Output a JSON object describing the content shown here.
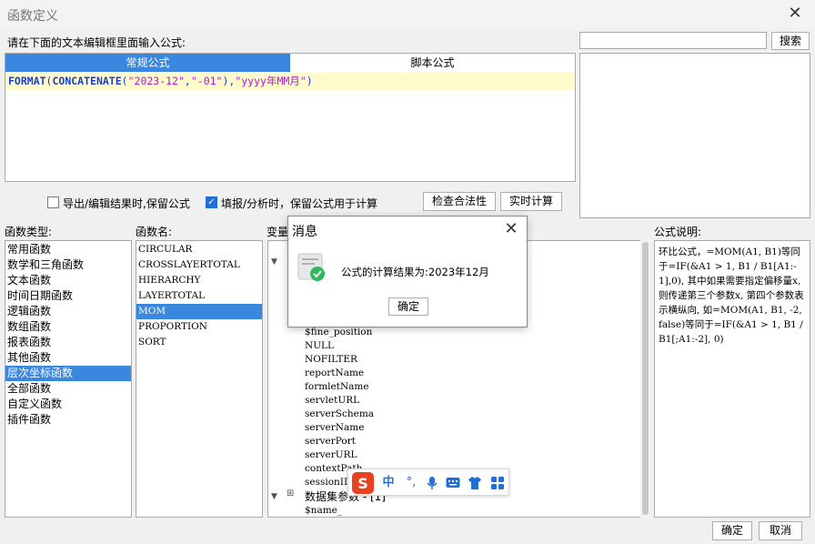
{
  "window": {
    "title": "函数定义"
  },
  "prompt": "请在下面的文本编辑框里面输入公式:",
  "search": {
    "value": "",
    "button": "搜索"
  },
  "tabs": {
    "normal": "常规公式",
    "script": "脚本公式"
  },
  "formula": {
    "parts": [
      "FORMAT",
      "(",
      "CONCATENATE",
      "(",
      "\"2023-12\"",
      ",",
      "\"-01\"",
      "),",
      "\"yyyy年MM月\"",
      ")"
    ]
  },
  "options": {
    "export_keep": {
      "label": "导出/编辑结果时,保留公式",
      "checked": false
    },
    "fill_keep": {
      "label": "填报/分析时，保留公式用于计算",
      "checked": true
    },
    "check_button": "检查合法性",
    "realtime_button": "实时计算"
  },
  "labels": {
    "func_type": "函数类型:",
    "func_name": "函数名:",
    "variables": "变量",
    "description": "公式说明:"
  },
  "func_types": [
    "常用函数",
    "数学和三角函数",
    "文本函数",
    "时间日期函数",
    "逻辑函数",
    "数组函数",
    "报表函数",
    "其他函数",
    "层次坐标函数",
    "全部函数",
    "自定义函数",
    "插件函数"
  ],
  "func_type_selected": 8,
  "func_names": [
    "CIRCULAR",
    "CROSSLAYERTOTAL",
    "HIERARCHY",
    "LAYERTOTAL",
    "MOM",
    "PROPORTION",
    "SORT"
  ],
  "func_name_selected": 4,
  "variables": {
    "items": [
      "$fine_position",
      "NULL",
      "NOFILTER",
      "reportName",
      "formletName",
      "servletURL",
      "serverSchema",
      "serverName",
      "serverPort",
      "serverURL",
      "contextPath",
      "sessionID"
    ],
    "dataset_group": "数据集参数 - [1]",
    "dataset_items": [
      "$name_"
    ]
  },
  "description_text": "环比公式，=MOM(A1, B1)等同于=IF(&A1 > 1, B1 / B1[A1:-1],0), 其中如果需要指定偏移量x, 则传递第三个参数x, 第四个参数表示横纵向, 如=MOM(A1, B1, -2, false)等同于=IF(&A1 > 1, B1 / B1[;A1:-2], 0)",
  "dialog": {
    "title": "消息",
    "message": "公式的计算结果为:2023年12月",
    "ok": "确定"
  },
  "ime": {
    "icons": [
      "sogou-logo",
      "中",
      "°,",
      "mic",
      "keyboard",
      "shirt",
      "grid"
    ],
    "chinese_label": "中",
    "punct_label": "°,"
  },
  "footer": {
    "ok": "确定",
    "cancel": "取消"
  },
  "colors": {
    "accent": "#3a87e0",
    "formula_bg": "#fffbcc",
    "function": "#1a3fd0",
    "string": "#b01ad0",
    "success": "#2eb85c",
    "sogou": "#e8421e"
  }
}
